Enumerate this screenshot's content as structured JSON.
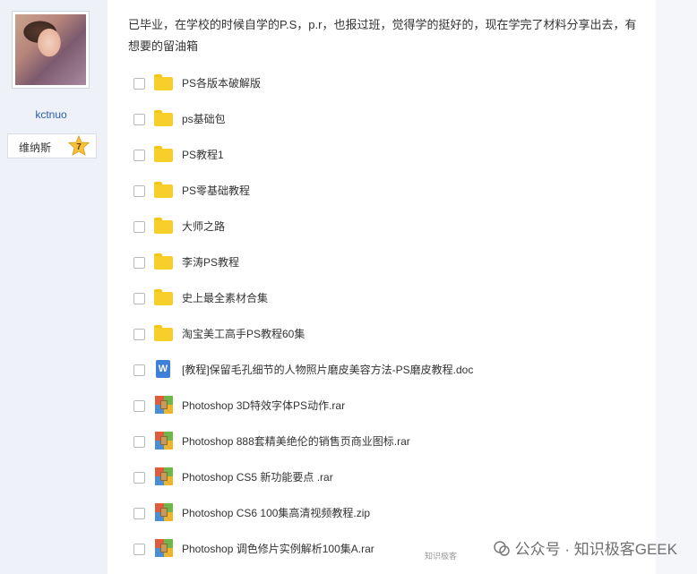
{
  "user": {
    "name": "kctnuo",
    "rank_label": "维纳斯",
    "rank_level": "7"
  },
  "post": {
    "text": "已毕业，在学校的时候自学的P.S，p.r，也报过班，觉得学的挺好的，现在学完了材料分享出去，有想要的留油箱"
  },
  "files": [
    {
      "name": "PS各版本破解版",
      "icon": "folder-icon"
    },
    {
      "name": "ps基础包",
      "icon": "folder-icon"
    },
    {
      "name": "PS教程1",
      "icon": "folder-icon"
    },
    {
      "name": "PS零基础教程",
      "icon": "folder-icon"
    },
    {
      "name": "大师之路",
      "icon": "folder-icon"
    },
    {
      "name": "李涛PS教程",
      "icon": "folder-icon"
    },
    {
      "name": "史上最全素材合集",
      "icon": "folder-icon"
    },
    {
      "name": "淘宝美工高手PS教程60集",
      "icon": "folder-icon"
    },
    {
      "name": "[教程]保留毛孔细节的人物照片磨皮美容方法-PS磨皮教程.doc",
      "icon": "word-doc-icon"
    },
    {
      "name": "Photoshop 3D特效字体PS动作.rar",
      "icon": "rar-archive-icon"
    },
    {
      "name": "Photoshop 888套精美绝伦的销售页商业图标.rar",
      "icon": "rar-archive-icon"
    },
    {
      "name": "Photoshop CS5 新功能要点 .rar",
      "icon": "rar-archive-icon"
    },
    {
      "name": "Photoshop CS6 100集高清视频教程.zip",
      "icon": "rar-archive-icon"
    },
    {
      "name": "Photoshop 调色修片实例解析100集A.rar",
      "icon": "rar-archive-icon"
    }
  ],
  "watermark": {
    "text": "公众号 · 知识极客GEEK",
    "subtext": "知识极客"
  },
  "colors": {
    "folder": "#f8ce2a",
    "word": "#3f7fd7",
    "username": "#2b5dab"
  }
}
